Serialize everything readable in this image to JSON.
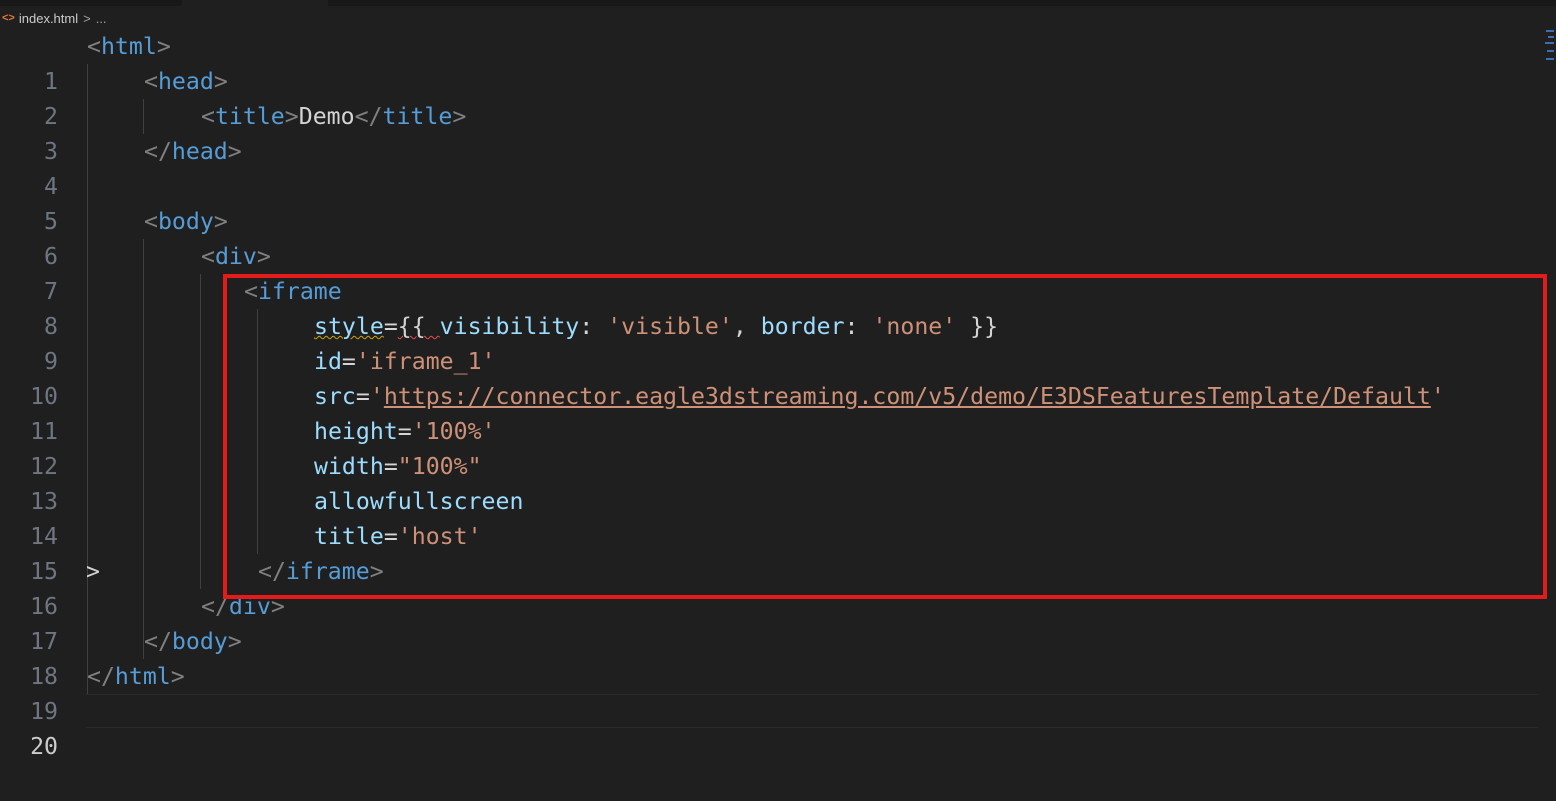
{
  "breadcrumb": {
    "file_icon": "<>",
    "file": "index.html",
    "separator": ">",
    "more": "..."
  },
  "lines": [
    {
      "n": "1"
    },
    {
      "n": "2"
    },
    {
      "n": "3"
    },
    {
      "n": "4"
    },
    {
      "n": "5"
    },
    {
      "n": "6"
    },
    {
      "n": "7"
    },
    {
      "n": "8"
    },
    {
      "n": "9"
    },
    {
      "n": "10"
    },
    {
      "n": "11"
    },
    {
      "n": "12"
    },
    {
      "n": "13"
    },
    {
      "n": "14"
    },
    {
      "n": "15"
    },
    {
      "n": "16"
    },
    {
      "n": "17"
    },
    {
      "n": "18"
    },
    {
      "n": "19"
    },
    {
      "n": "20"
    }
  ],
  "code": {
    "html_tag": "html",
    "head_tag": "head",
    "title_tag": "title",
    "title_text": "Demo",
    "body_tag": "body",
    "div_tag": "div",
    "iframe_tag": "iframe",
    "style_attr": "style",
    "style_value_open": "{{ ",
    "style_key_visibility": "visibility",
    "style_val_visible": "'visible'",
    "style_key_border": "border",
    "style_val_none": "'none'",
    "style_value_close": " }}",
    "id_attr": "id",
    "id_value": "'iframe_1'",
    "src_attr": "src",
    "src_value": "https://connector.eagle3dstreaming.com/v5/demo/E3DSFeaturesTemplate/Default",
    "height_attr": "height",
    "height_value": "'100%'",
    "width_attr": "width",
    "width_value": "\"100%\"",
    "allowfullscreen_attr": "allowfullscreen",
    "title_attr": "title",
    "title_value": "'host'",
    "fold_marker": ">"
  },
  "highlight": {
    "color": "#e31b1b"
  },
  "colors": {
    "background": "#1f1f1f",
    "tag": "#569cd6",
    "attr": "#9cdcfe",
    "string": "#ce9178"
  }
}
